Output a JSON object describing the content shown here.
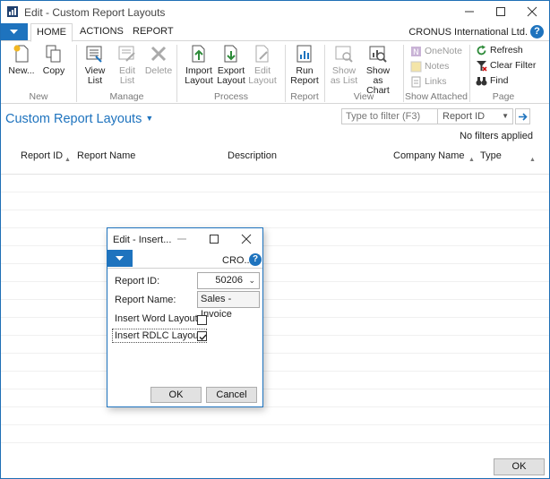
{
  "window": {
    "title": "Edit - Custom Report Layouts"
  },
  "ribbon": {
    "tabs": [
      "HOME",
      "ACTIONS",
      "REPORT"
    ],
    "company": "CRONUS International Ltd.",
    "groups": {
      "new": {
        "label": "New",
        "buttons": [
          "New...",
          "Copy"
        ]
      },
      "manage": {
        "label": "Manage",
        "buttons": [
          "View List",
          "Edit List",
          "Delete"
        ]
      },
      "process": {
        "label": "Process",
        "buttons": [
          "Import Layout",
          "Export Layout",
          "Edit Layout"
        ]
      },
      "report": {
        "label": "Report",
        "buttons": [
          "Run Report"
        ]
      },
      "view": {
        "label": "View",
        "buttons": [
          "Show as List",
          "Show as Chart"
        ]
      },
      "show_attached": {
        "label": "Show Attached",
        "buttons": [
          "OneNote",
          "Notes",
          "Links"
        ]
      },
      "page": {
        "label": "Page",
        "buttons": [
          "Refresh",
          "Clear Filter",
          "Find"
        ]
      }
    }
  },
  "page": {
    "title": "Custom Report Layouts",
    "filter_placeholder": "Type to filter (F3)",
    "filter_field": "Report ID",
    "no_filters": "No filters applied",
    "columns": [
      "Report ID",
      "Report Name",
      "Description",
      "Company Name",
      "Type"
    ],
    "ok": "OK"
  },
  "dialog": {
    "title": "Edit - Insert...",
    "company": "CRO...",
    "report_id_label": "Report ID:",
    "report_id": "50206",
    "report_name_label": "Report Name:",
    "report_name": "Sales - Invoice",
    "word_label": "Insert Word Layout:",
    "word_checked": false,
    "rdlc_label": "Insert RDLC Layout:",
    "rdlc_checked": true,
    "ok": "OK",
    "cancel": "Cancel"
  },
  "colors": {
    "accent": "#1e73be",
    "disabled": "#9a9a9a"
  }
}
